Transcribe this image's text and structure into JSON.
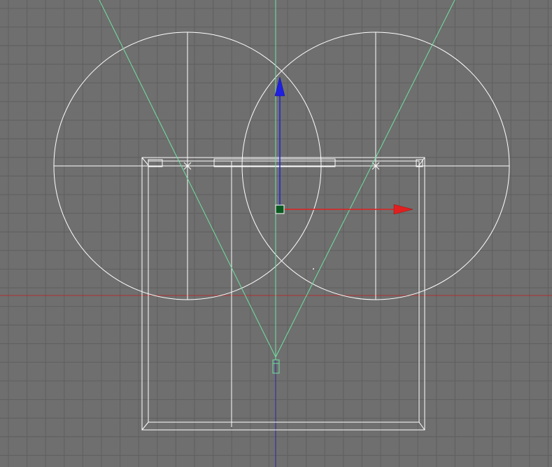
{
  "viewport": {
    "name": "camera-viewport",
    "colors": {
      "background": "#6f6f6f",
      "grid_line": "#5f5f5f",
      "world_x_axis": "#b03030",
      "world_z_axis": "#2a2a9a",
      "wireframe": "#ffffff",
      "camera_frustum": "#6fe0a0",
      "gizmo_x": "#e02020",
      "gizmo_y": "#2020e0",
      "pivot_fill": "#0a5a20"
    }
  },
  "gizmo": {
    "x_arrow_icon": "move-arrow-x-icon",
    "y_arrow_icon": "move-arrow-y-icon",
    "pivot_icon": "pivot-handle-icon"
  }
}
